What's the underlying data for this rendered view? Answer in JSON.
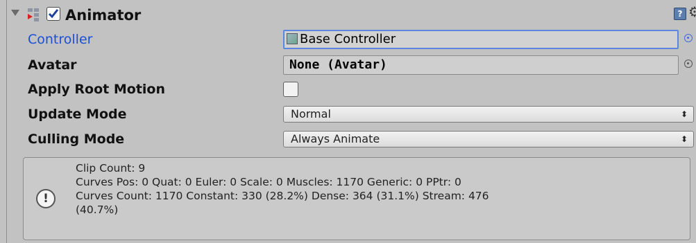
{
  "component": {
    "title": "Animator",
    "enabled": true,
    "help_icon": "help-book-icon",
    "settings_icon": "gear-icon"
  },
  "fields": {
    "controller": {
      "label": "Controller",
      "value": "Base Controller"
    },
    "avatar": {
      "label": "Avatar",
      "value": "None (Avatar)"
    },
    "apply_root_motion": {
      "label": "Apply Root Motion",
      "checked": false
    },
    "update_mode": {
      "label": "Update Mode",
      "value": "Normal"
    },
    "culling_mode": {
      "label": "Culling Mode",
      "value": "Always Animate"
    }
  },
  "info": {
    "line1": "Clip Count: 9",
    "line2": "Curves Pos: 0 Quat: 0 Euler: 0 Scale: 0 Muscles: 1170 Generic: 0 PPtr: 0",
    "line3": "Curves Count: 1170 Constant: 330 (28.2%) Dense: 364 (31.1%) Stream: 476",
    "line4": "(40.7%)"
  },
  "colors": {
    "panel_bg": "#c2c2c2",
    "active_label": "#1a4fd6",
    "focus_border": "#5c85e0"
  }
}
